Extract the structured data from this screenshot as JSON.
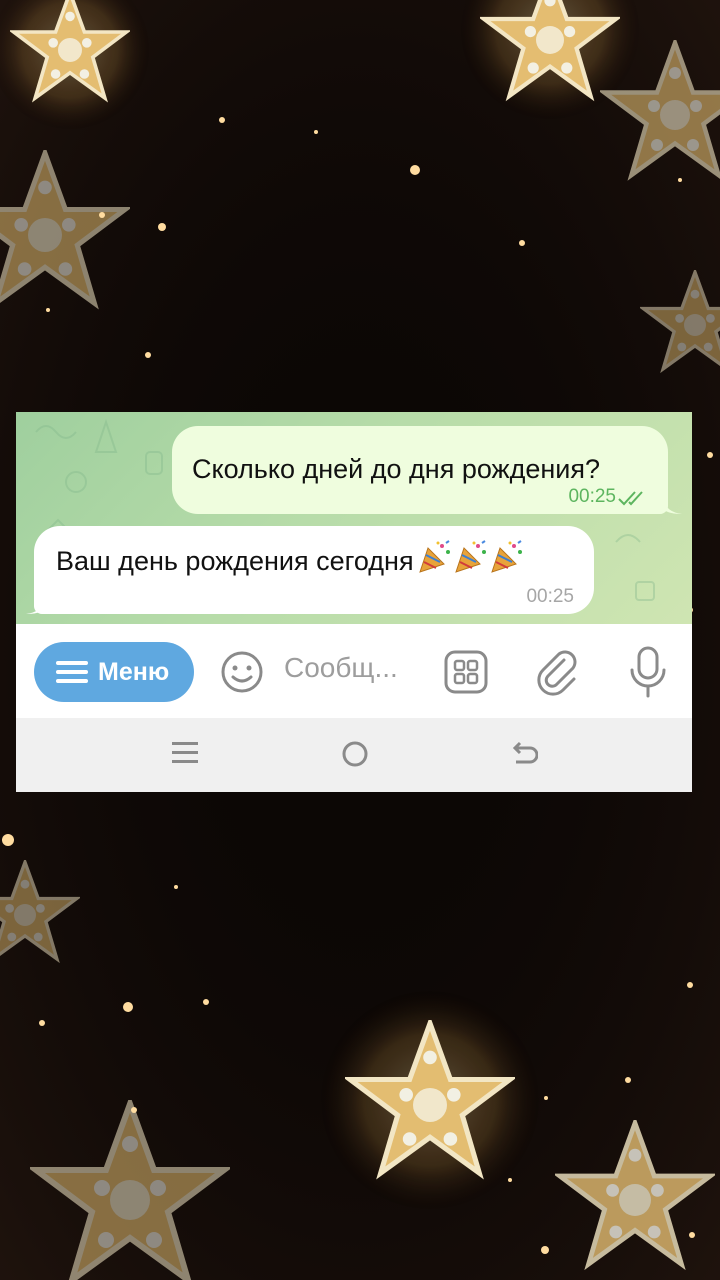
{
  "chat": {
    "messages": [
      {
        "direction": "outgoing",
        "text": "Сколько дней до дня рождения?",
        "time": "00:25",
        "status": "read"
      },
      {
        "direction": "incoming",
        "text": "Ваш день рождения сегодня",
        "emoji": "party-popper-icon x3",
        "time": "00:25"
      }
    ]
  },
  "input_bar": {
    "menu_label": "Меню",
    "placeholder": "Сообщ..."
  },
  "colors": {
    "outgoing_bubble": "#effdde",
    "incoming_bubble": "#ffffff",
    "menu_button": "#5fa8e0",
    "read_ticks": "#5db55f",
    "chat_background": "#b7dca9"
  }
}
